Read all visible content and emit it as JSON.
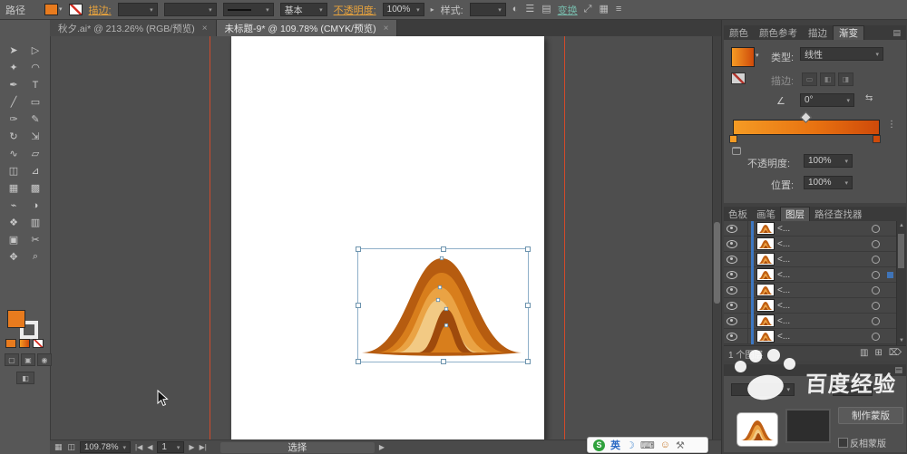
{
  "window": {
    "path_panel_label": "路径"
  },
  "palette": {
    "accent_fill": "#e87b1e",
    "guide_red": "#d14a2a",
    "selection_blue": "#8fb0c9",
    "layer_color": "#3c77c2"
  },
  "topbar": {
    "stroke_link": "描边:",
    "basic_style": "基本",
    "opacity_link": "不透明度:",
    "opacity_value": "100%",
    "style_label": "样式:",
    "transform_link": "变换",
    "mid_icons": [
      {
        "name": "document-setup-icon",
        "glyph": "◐"
      },
      {
        "name": "menu-icon",
        "glyph": "☰"
      },
      {
        "name": "panel-icon",
        "glyph": "▤"
      }
    ],
    "right_icons": [
      {
        "name": "arrange-icon",
        "glyph": "⤢"
      },
      {
        "name": "grid-icon",
        "glyph": "▦"
      },
      {
        "name": "options-icon",
        "glyph": "≡"
      }
    ]
  },
  "document_tabs": [
    {
      "label": "秋夕.ai* @ 213.26% (RGB/预览)",
      "close_glyph": "×",
      "active": false
    },
    {
      "label": "未标题-9* @ 109.78% (CMYK/预览)",
      "close_glyph": "×",
      "active": true
    }
  ],
  "tools": [
    {
      "name": "selection-tool",
      "glyph": "➤"
    },
    {
      "name": "direct-selection-tool",
      "glyph": "▷"
    },
    {
      "name": "magic-wand-tool",
      "glyph": "✦"
    },
    {
      "name": "lasso-tool",
      "glyph": "◠"
    },
    {
      "name": "pen-tool",
      "glyph": "✒"
    },
    {
      "name": "type-tool",
      "glyph": "T"
    },
    {
      "name": "line-segment-tool",
      "glyph": "╱"
    },
    {
      "name": "rectangle-tool",
      "glyph": "▭"
    },
    {
      "name": "paintbrush-tool",
      "glyph": "✑"
    },
    {
      "name": "pencil-tool",
      "glyph": "✎"
    },
    {
      "name": "rotate-tool",
      "glyph": "↻"
    },
    {
      "name": "scale-tool",
      "glyph": "⇲"
    },
    {
      "name": "width-tool",
      "glyph": "∿"
    },
    {
      "name": "free-transform-tool",
      "glyph": "▱"
    },
    {
      "name": "shape-builder-tool",
      "glyph": "◫"
    },
    {
      "name": "perspective-grid-tool",
      "glyph": "⊿"
    },
    {
      "name": "mesh-tool",
      "glyph": "▦"
    },
    {
      "name": "gradient-tool",
      "glyph": "▩"
    },
    {
      "name": "eyedropper-tool",
      "glyph": "⌁"
    },
    {
      "name": "blend-tool",
      "glyph": "◑"
    },
    {
      "name": "symbol-sprayer-tool",
      "glyph": "❖"
    },
    {
      "name": "column-graph-tool",
      "glyph": "▥"
    },
    {
      "name": "artboard-tool",
      "glyph": "▣"
    },
    {
      "name": "slice-tool",
      "glyph": "✂"
    },
    {
      "name": "hand-tool",
      "glyph": "✥"
    },
    {
      "name": "zoom-tool",
      "glyph": "⌕"
    }
  ],
  "art": {
    "colors": [
      "#b65c10",
      "#d87e1c",
      "#eaa344",
      "#f2ca84",
      "#9e4a0c",
      "#d87e1c"
    ]
  },
  "gradient_panel": {
    "tabs": [
      {
        "label": "颜色",
        "active": false
      },
      {
        "label": "颜色参考",
        "active": false
      },
      {
        "label": "描边",
        "active": false
      },
      {
        "label": "渐变",
        "active": true
      }
    ],
    "menu_glyph": "▤",
    "type_label": "类型:",
    "type_value": "线性",
    "stroke_label": "描边:",
    "stroke_icons": [
      {
        "name": "stroke-within-icon",
        "glyph": "▭"
      },
      {
        "name": "stroke-along-icon",
        "glyph": "◧"
      },
      {
        "name": "stroke-across-icon",
        "glyph": "◨"
      }
    ],
    "angle_glyph": "∠",
    "angle_value": "0°",
    "gradient_stops": [
      "#f59b24",
      "#cf4a0a"
    ],
    "opacity_label": "不透明度:",
    "opacity_value": "100%",
    "position_label": "位置:",
    "position_value": "100%"
  },
  "layers_panel": {
    "tabs": [
      {
        "label": "色板",
        "active": false
      },
      {
        "label": "画笔",
        "active": false
      },
      {
        "label": "图层",
        "active": true
      },
      {
        "label": "路径查找器",
        "active": false
      }
    ],
    "menu_glyph": "▤",
    "items": [
      {
        "name": "<...",
        "selected": false
      },
      {
        "name": "<...",
        "selected": false
      },
      {
        "name": "<...",
        "selected": false
      },
      {
        "name": "<...",
        "selected": true
      },
      {
        "name": "<...",
        "selected": false
      },
      {
        "name": "<...",
        "selected": false
      },
      {
        "name": "<...",
        "selected": false
      },
      {
        "name": "<...",
        "selected": false
      }
    ],
    "footer_count": "1 个图层",
    "footer_icons": [
      {
        "name": "make-clip-mask-icon",
        "glyph": "▥"
      },
      {
        "name": "new-layer-icon",
        "glyph": "⊞"
      },
      {
        "name": "delete-layer-icon",
        "glyph": "⌦"
      }
    ]
  },
  "transparency_panel": {
    "make_mask_label": "制作蒙版",
    "invert_mask_label": "反相蒙版"
  },
  "statusbar": {
    "left_icons": [
      {
        "name": "pages-icon",
        "glyph": "▦"
      },
      {
        "name": "artboard-nav-icon",
        "glyph": "◫"
      }
    ],
    "zoom": "109.78%",
    "nav_first": "|◀",
    "nav_prev": "◀",
    "artboard": "1",
    "nav_next": "▶",
    "nav_last": "▶|",
    "status": "选择",
    "arrow": "▶"
  },
  "ime": {
    "items": [
      {
        "name": "sogou-logo",
        "glyph": "S",
        "cls": "sogou"
      },
      {
        "name": "lang-indicator",
        "glyph": "英",
        "cls": "lang"
      },
      {
        "name": "night-mode-icon",
        "glyph": "☽",
        "cls": "moon"
      },
      {
        "name": "soft-keyboard-icon",
        "glyph": "⌨",
        "cls": "kbd"
      },
      {
        "name": "emoji-icon",
        "glyph": "☺",
        "cls": "emo"
      },
      {
        "name": "toolbox-icon",
        "glyph": "⚒",
        "cls": "tool"
      }
    ]
  },
  "watermark": {
    "text": "百度经验"
  }
}
